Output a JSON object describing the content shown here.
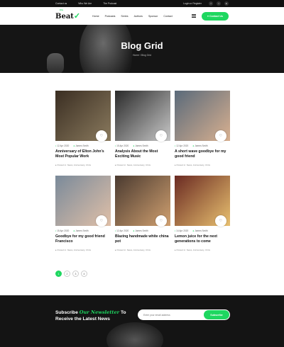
{
  "topbar": {
    "links": [
      "Contact us",
      "Who We Are",
      "The Podcast"
    ],
    "login": "Login or Register",
    "social": [
      "f",
      "t",
      "in"
    ]
  },
  "header": {
    "logo_text": "Beat",
    "logo_tag": "On",
    "nav": [
      "Home",
      "Podcasts",
      "Series",
      "Authors",
      "Sponsor",
      "Contact"
    ],
    "cta": "Contact Us"
  },
  "hero": {
    "title": "Blog Grid",
    "breadcrumb": "Home / Blog Grid"
  },
  "posts": [
    {
      "date": "12 Apr 2020",
      "author": "James Smith",
      "title": "Anniversary of Elton John's Most Popular Work",
      "cats": "Posted in: News, Anniversary, Chris",
      "thumb": [
        "#3a2e22",
        "#8a7a5e"
      ]
    },
    {
      "date": "15 Apr 2020",
      "author": "James Smith",
      "title": "Analysis About the Most Exciting Music",
      "cats": "Posted in: News, Anniversary, Chris",
      "thumb": [
        "#2a2a2a",
        "#c8c8c8"
      ]
    },
    {
      "date": "12 Apr 2020",
      "author": "James Smith",
      "title": "A short wave goodbye for my good friend",
      "cats": "Posted in: News, Anniversary, Chris",
      "thumb": [
        "#5a6a7a",
        "#d8b090"
      ]
    },
    {
      "date": "15 Apr 2020",
      "author": "James Smith",
      "title": "Goodbye for my good friend Francisco",
      "cats": "Posted in: News, Anniversary, Chris",
      "thumb": [
        "#7a8a9a",
        "#e0c0a8"
      ]
    },
    {
      "date": "12 Apr 2020",
      "author": "James Smith",
      "title": "Blazing handmade white china pot",
      "cats": "Posted in: News, Anniversary, Chris",
      "thumb": [
        "#4a3a30",
        "#d0a070"
      ]
    },
    {
      "date": "14 Apr 2020",
      "author": "James Smith",
      "title": "Lemon juice for the next generations to come",
      "cats": "Posted in: News, Anniversary, Chris",
      "thumb": [
        "#6a2a22",
        "#e8c070"
      ]
    }
  ],
  "pagination": [
    "1",
    "2",
    "3",
    "4"
  ],
  "newsletter": {
    "title_pre": "Subscribe",
    "title_highlight": "Our Newsletter",
    "title_post": "To",
    "title_line2": "Receive the Latest News",
    "placeholder": "Enter your email address",
    "button": "Subscribe"
  },
  "colors": {
    "accent": "#1ed760",
    "dark": "#141414"
  }
}
